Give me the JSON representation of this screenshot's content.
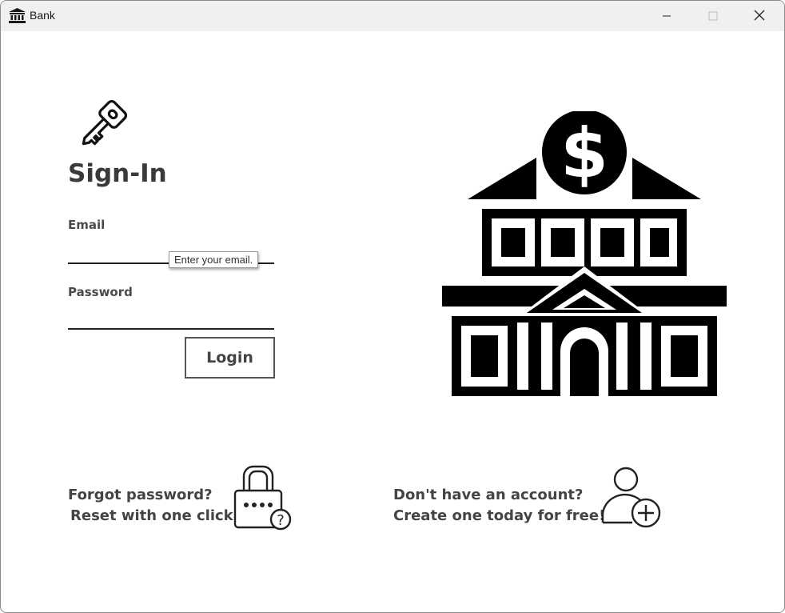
{
  "window": {
    "title": "Bank",
    "app_icon": "bank-building-icon",
    "controls": [
      "minimize-icon",
      "maximize-icon",
      "close-icon"
    ]
  },
  "signin": {
    "icon": "key-icon",
    "heading": "Sign-In",
    "email_label": "Email",
    "email_value": "",
    "email_tooltip": "Enter your email.",
    "password_label": "Password",
    "password_value": "",
    "login_label": "Login"
  },
  "illustration": {
    "icon": "bank-dollar-icon"
  },
  "forgot": {
    "line1": "Forgot password?",
    "line2": "Reset with one click!",
    "icon": "lock-question-icon"
  },
  "signup": {
    "line1": "Don't have an account?",
    "line2": "Create one today for free!",
    "icon": "add-user-icon"
  }
}
